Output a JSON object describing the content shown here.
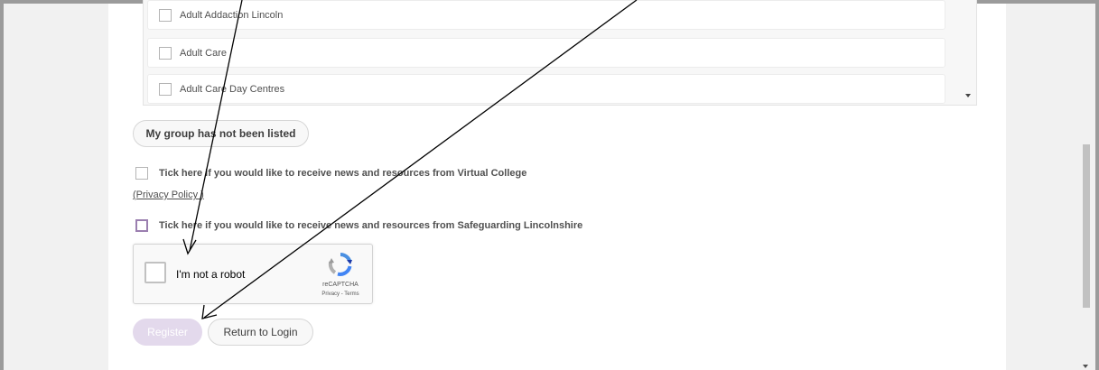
{
  "groups": {
    "items": [
      {
        "label": "Adult Addaction Lincoln"
      },
      {
        "label": "Adult Care"
      },
      {
        "label": "Adult Care Day Centres"
      }
    ]
  },
  "buttons": {
    "group_not_listed": "My group has not been listed",
    "register": "Register",
    "return_to_login": "Return to Login"
  },
  "options": {
    "virtual_college": "Tick here if you would like to receive news and resources from Virtual College",
    "privacy_policy": "(Privacy Policy )",
    "safeguarding": "Tick here if you would like to receive news and resources from Safeguarding Lincolnshire"
  },
  "recaptcha": {
    "label": "I'm not a robot",
    "brand": "reCAPTCHA",
    "links": "Privacy - Terms"
  },
  "colors": {
    "register_bg": "#e3d9ec",
    "register_text": "#ffffff",
    "safeguarding_checkbox": "#9b7fb0",
    "default_checkbox": "#b5b5b5"
  }
}
